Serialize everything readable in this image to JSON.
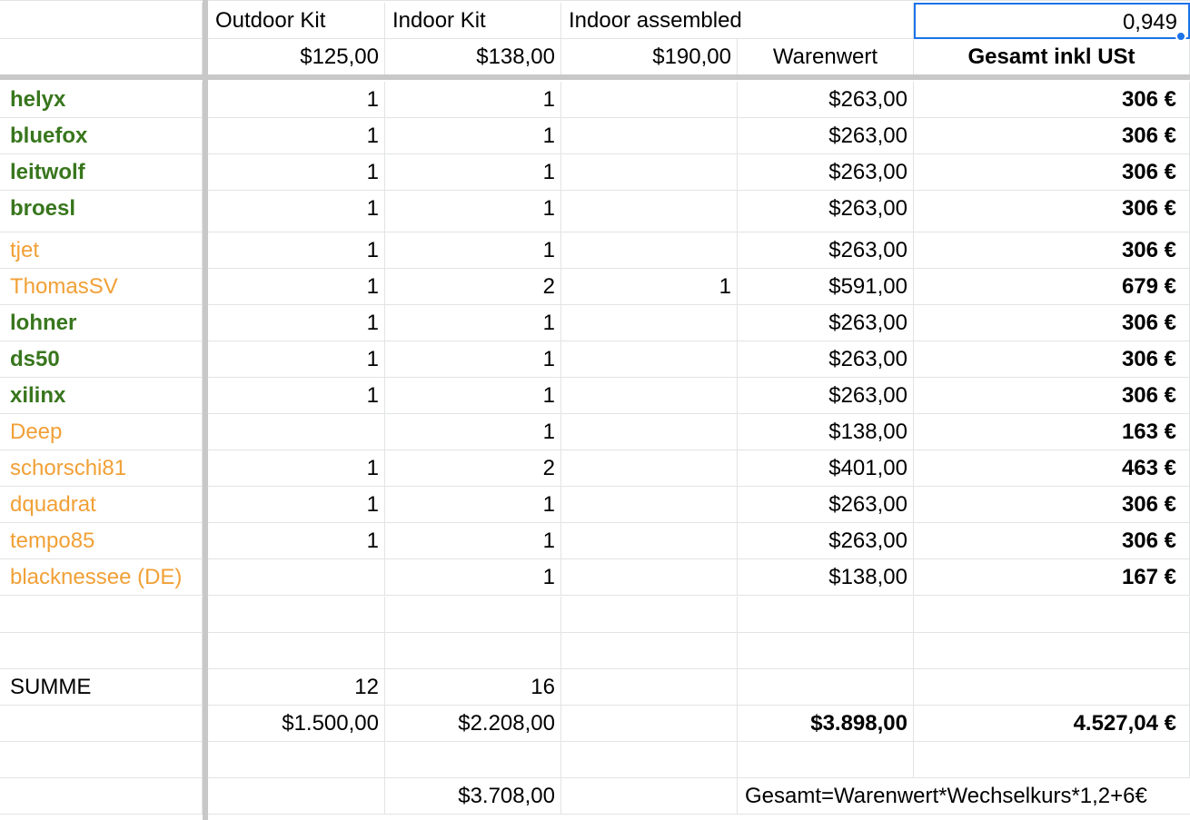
{
  "header": {
    "row1": {
      "c1": "Outdoor Kit",
      "c2": "Indoor Kit",
      "c3": "Indoor assembled",
      "c5": "0,949"
    },
    "row2": {
      "c1": "$125,00",
      "c2": "$138,00",
      "c3": "$190,00",
      "c4": "Warenwert",
      "c5": "Gesamt inkl USt"
    }
  },
  "rows": [
    {
      "name": "helyx",
      "style": "green",
      "outdoor": "1",
      "indoor": "1",
      "assembled": "",
      "warenwert": "$263,00",
      "gesamt": "306 €"
    },
    {
      "name": "bluefox",
      "style": "green",
      "outdoor": "1",
      "indoor": "1",
      "assembled": "",
      "warenwert": "$263,00",
      "gesamt": "306 €"
    },
    {
      "name": "leitwolf",
      "style": "green",
      "outdoor": "1",
      "indoor": "1",
      "assembled": "",
      "warenwert": "$263,00",
      "gesamt": "306 €"
    },
    {
      "name": "broesl",
      "style": "green",
      "outdoor": "1",
      "indoor": "1",
      "assembled": "",
      "warenwert": "$263,00",
      "gesamt": "306 €"
    },
    {
      "name": "tjet",
      "style": "orange",
      "outdoor": "1",
      "indoor": "1",
      "assembled": "",
      "warenwert": "$263,00",
      "gesamt": "306 €"
    },
    {
      "name": "ThomasSV",
      "style": "orange",
      "outdoor": "1",
      "indoor": "2",
      "assembled": "1",
      "warenwert": "$591,00",
      "gesamt": "679 €"
    },
    {
      "name": "lohner",
      "style": "green",
      "outdoor": "1",
      "indoor": "1",
      "assembled": "",
      "warenwert": "$263,00",
      "gesamt": "306 €"
    },
    {
      "name": "ds50",
      "style": "green",
      "outdoor": "1",
      "indoor": "1",
      "assembled": "",
      "warenwert": "$263,00",
      "gesamt": "306 €"
    },
    {
      "name": "xilinx",
      "style": "green",
      "outdoor": "1",
      "indoor": "1",
      "assembled": "",
      "warenwert": "$263,00",
      "gesamt": "306 €"
    },
    {
      "name": "Deep",
      "style": "orange",
      "outdoor": "",
      "indoor": "1",
      "assembled": "",
      "warenwert": "$138,00",
      "gesamt": "163 €"
    },
    {
      "name": "schorschi81",
      "style": "orange",
      "outdoor": "1",
      "indoor": "2",
      "assembled": "",
      "warenwert": "$401,00",
      "gesamt": "463 €"
    },
    {
      "name": "dquadrat",
      "style": "orange",
      "outdoor": "1",
      "indoor": "1",
      "assembled": "",
      "warenwert": "$263,00",
      "gesamt": "306 €"
    },
    {
      "name": "tempo85",
      "style": "orange",
      "outdoor": "1",
      "indoor": "1",
      "assembled": "",
      "warenwert": "$263,00",
      "gesamt": "306 €"
    },
    {
      "name": "blacknessee (DE)",
      "style": "orange",
      "outdoor": "",
      "indoor": "1",
      "assembled": "",
      "warenwert": "$138,00",
      "gesamt": "167 €"
    }
  ],
  "summary": {
    "label": "SUMME",
    "outdoor_count": "12",
    "indoor_count": "16",
    "outdoor_total": "$1.500,00",
    "indoor_total": "$2.208,00",
    "warenwert_total": "$3.898,00",
    "gesamt_total": "4.527,04 €",
    "kits_total": "$3.708,00",
    "formula_note": "Gesamt=Warenwert*Wechselkurs*1,2+6€"
  }
}
